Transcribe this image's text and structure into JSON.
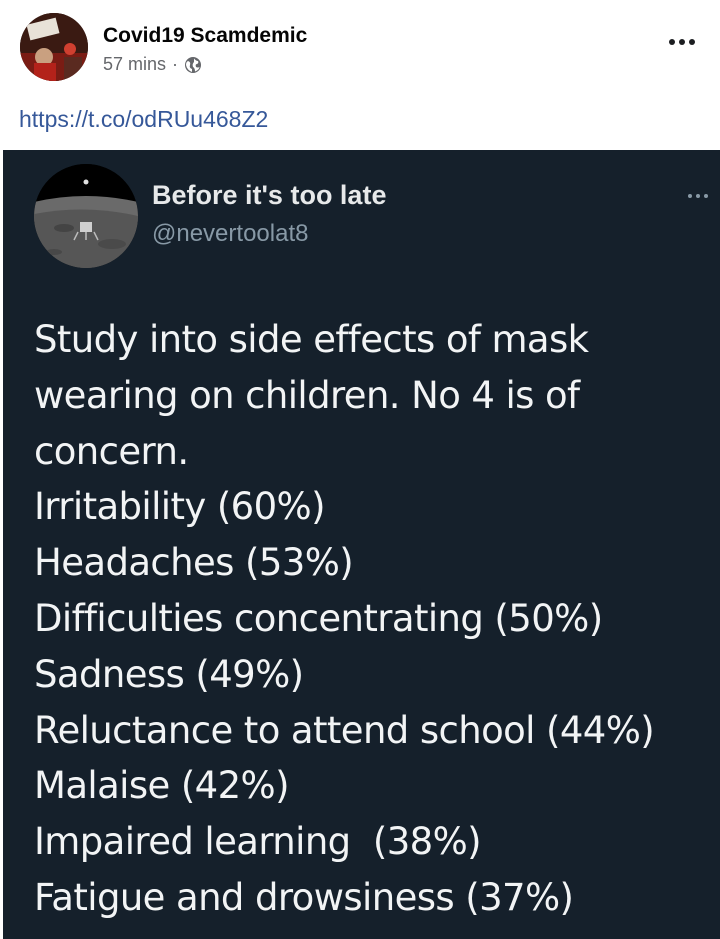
{
  "post": {
    "author": "Covid19 Scamdemic",
    "time": "57 mins",
    "separator": "·",
    "privacy_icon": "globe-icon",
    "link": "https://t.co/odRUu468Z2"
  },
  "tweet": {
    "name": "Before it's too late",
    "handle": "@nevertoolat8",
    "lines": [
      "Study into side effects of mask",
      "wearing on children. No 4 is of",
      "concern.",
      "Irritability (60%)",
      "Headaches (53%)",
      "Difficulties concentrating (50%)",
      "Sadness (49%)",
      "Reluctance to attend school (44%)",
      "Malaise (42%)",
      "Impaired learning  (38%)",
      "Fatigue and drowsiness (37%)"
    ]
  },
  "colors": {
    "tweet_background": "#15202b",
    "link": "#365899",
    "secondary_text": "#65676b"
  }
}
